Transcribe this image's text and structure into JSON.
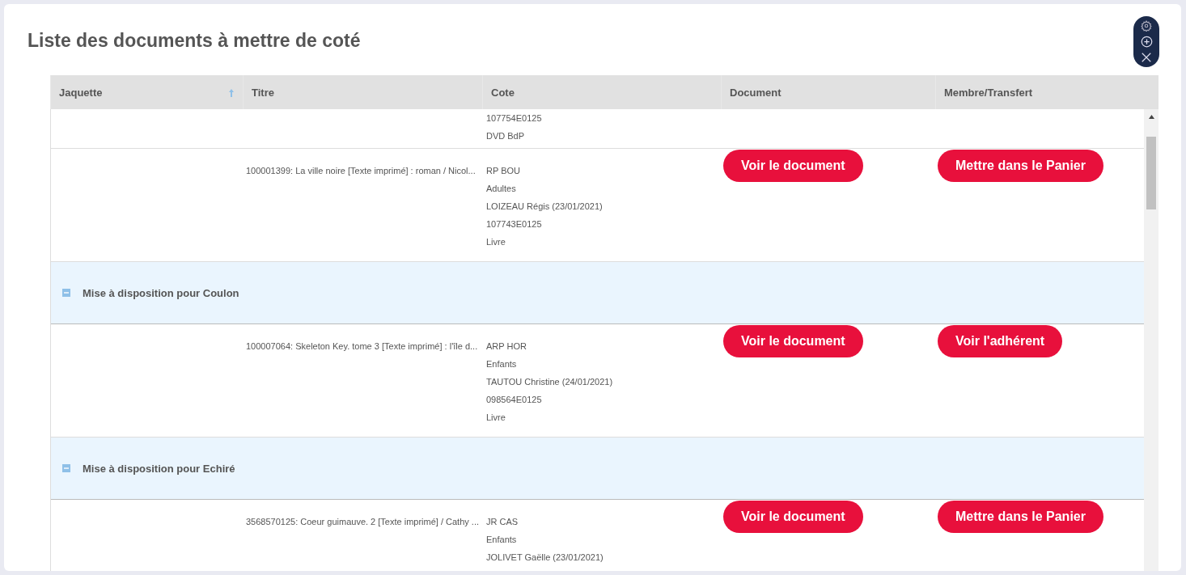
{
  "page": {
    "title": "Liste des documents à mettre de coté"
  },
  "table": {
    "columns": [
      {
        "label": "Jaquette",
        "sorted": true
      },
      {
        "label": "Titre",
        "sorted": false
      },
      {
        "label": "Cote",
        "sorted": false
      },
      {
        "label": "Document",
        "sorted": false
      },
      {
        "label": "Membre/Transfert",
        "sorted": false
      }
    ],
    "rows": [
      {
        "kind": "item",
        "partial": true,
        "cote": [
          "107754E0125",
          "DVD BdP"
        ]
      },
      {
        "kind": "item",
        "partial": false,
        "title": "100001399: La ville noire [Texte imprimé] : roman / Nicol...",
        "cote": [
          "RP BOU",
          "Adultes",
          "LOIZEAU Régis (23/01/2021)",
          "107743E0125",
          "Livre"
        ],
        "document_button": "Voir le document",
        "member_button": "Mettre dans le Panier"
      },
      {
        "kind": "group",
        "expanded": true,
        "label": "Mise à disposition pour Coulon"
      },
      {
        "kind": "item",
        "partial": false,
        "title": "100007064: Skeleton Key. tome 3 [Texte imprimé] : l'île d...",
        "cote": [
          "ARP HOR",
          "Enfants",
          "TAUTOU Christine (24/01/2021)",
          "098564E0125",
          "Livre"
        ],
        "document_button": "Voir le document",
        "member_button": "Voir l'adhérent"
      },
      {
        "kind": "group",
        "expanded": true,
        "label": "Mise à disposition pour Echiré"
      },
      {
        "kind": "item",
        "partial": false,
        "title": "3568570125: Coeur guimauve. 2 [Texte imprimé] / Cathy ...",
        "cote": [
          "JR CAS",
          "Enfants",
          "JOLIVET Gaëlle (23/01/2021)"
        ],
        "document_button": "Voir le document",
        "member_button": "Mettre dans le Panier"
      }
    ]
  }
}
